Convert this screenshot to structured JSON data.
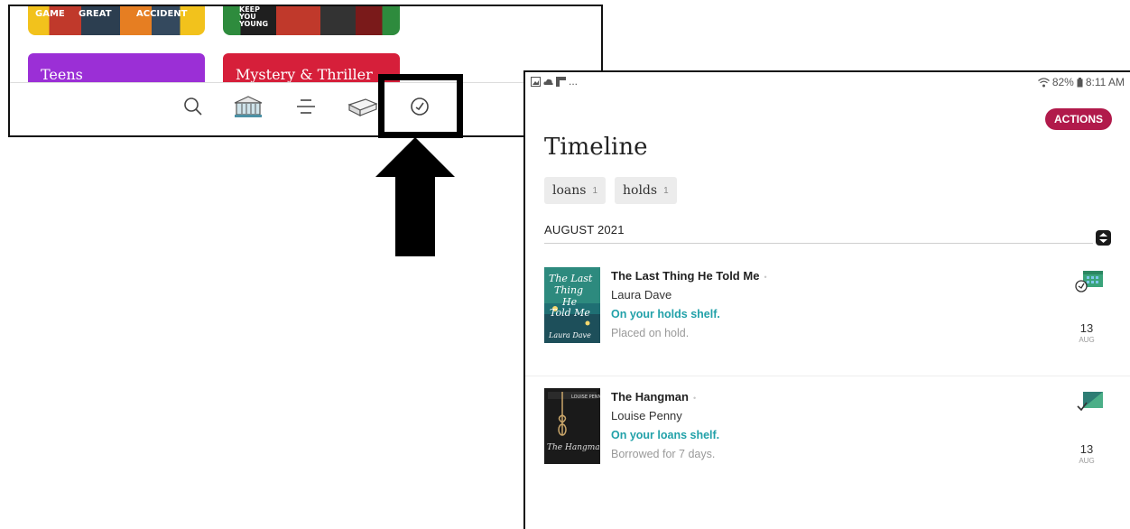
{
  "left_panel": {
    "cover_texts": [
      "GAME",
      "GREAT",
      "ACCIDENT"
    ],
    "cover_texts_b": "KEEP YOU YOUNG",
    "genres": [
      {
        "label": "Teens",
        "color": "#9b2fd6"
      },
      {
        "label": "Mystery & Thriller",
        "color": "#d61f3a"
      }
    ],
    "nav_icons": [
      "search-icon",
      "library-icon",
      "menu-icon",
      "shelf-icon",
      "timeline-icon"
    ],
    "highlighted": "timeline-icon"
  },
  "status_bar": {
    "left_glyphs": [
      "image-icon",
      "cloud-icon",
      "flipboard-icon"
    ],
    "ellipsis": "...",
    "battery": "82%",
    "time": "8:11 AM"
  },
  "header": {
    "actions_label": "ACTIONS",
    "title": "Timeline"
  },
  "filters": [
    {
      "label": "loans",
      "count": "1"
    },
    {
      "label": "holds",
      "count": "1"
    }
  ],
  "section": {
    "month": "AUGUST 2021"
  },
  "entries": [
    {
      "title": "The Last Thing He Told Me",
      "dot": "•",
      "author": "Laura Dave",
      "status": "On your holds shelf.",
      "note": "Placed on hold.",
      "day": "13",
      "month": "AUG",
      "icon": "hold-calendar-icon",
      "cover_color": "#1f6f73"
    },
    {
      "title": "The Hangman",
      "dot": "•",
      "author": "Louise Penny",
      "status": "On your loans shelf.",
      "note": "Borrowed for 7 days.",
      "day": "13",
      "month": "AUG",
      "icon": "borrowed-book-icon",
      "cover_color": "#1a1a1a"
    }
  ],
  "colors": {
    "accent": "#b11a4b",
    "status_teal": "#22a1a9"
  }
}
